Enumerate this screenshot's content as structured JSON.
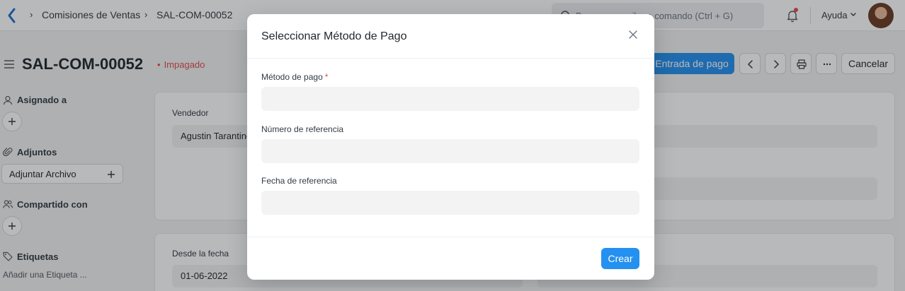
{
  "navbar": {
    "breadcrumbs": [
      "Comisiones de Ventas",
      "SAL-COM-00052"
    ],
    "search_placeholder": "Buscar o escriba o comando (Ctrl + G)",
    "help_label": "Ayuda"
  },
  "page": {
    "title": "SAL-COM-00052",
    "status": "Impagado",
    "primary_action": "Entrada de pago",
    "cancel_label": "Cancelar"
  },
  "sidebar": {
    "assigned_label": "Asignado a",
    "attachments_label": "Adjuntos",
    "attach_button": "Adjuntar Archivo",
    "shared_label": "Compartido con",
    "tags_label": "Etiquetas",
    "add_tag": "Añadir una Etiqueta ..."
  },
  "form": {
    "vendor_label": "Vendedor",
    "vendor_value": "Agustin Tarantino",
    "from_date_label": "Desde la fecha",
    "from_date_value": "01-06-2022"
  },
  "modal": {
    "title": "Seleccionar Método de Pago",
    "fields": [
      {
        "label": "Método de pago",
        "required": "*",
        "value": ""
      },
      {
        "label": "Número de referencia",
        "value": ""
      },
      {
        "label": "Fecha de referencia",
        "value": ""
      }
    ],
    "submit_label": "Crear"
  },
  "colors": {
    "primary": "#2490ef",
    "danger": "#e24c4c"
  }
}
